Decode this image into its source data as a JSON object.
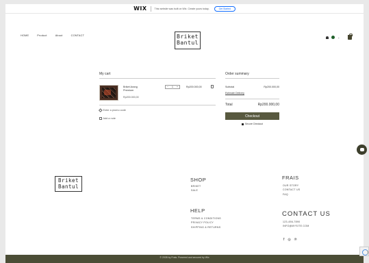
{
  "banner": {
    "logo": "WIX",
    "text": "This website was built on Wix. Create yours today.",
    "button": "Get Started"
  },
  "nav": [
    "HOME",
    "Product",
    "About",
    "CONTACT"
  ],
  "brand": {
    "line1": "Briket",
    "line2": "Bantul"
  },
  "cart": {
    "title": "My cart",
    "item": {
      "name": "Briket Arang Premium",
      "price": "Rp200.000,00",
      "qty": "1",
      "total": "Rp200.000,00"
    },
    "promo": "Enter a promo code",
    "note": "Add a note"
  },
  "summary": {
    "title": "Order summary",
    "subtotal_label": "Subtotal",
    "subtotal_value": "Rp200.000,00",
    "estimate": "Estimate Delivery",
    "total_label": "Total",
    "total_value": "Rp200.000,00",
    "checkout": "Checkout",
    "secure": "Secure Checkout"
  },
  "footer": {
    "shop": {
      "title": "SHOP",
      "links": [
        "BRIKET",
        "SALE"
      ]
    },
    "help": {
      "title": "HELP",
      "links": [
        "TERMS & CONDITIONS",
        "PRIVACY POLICY",
        "SHIPPING & RETURNS"
      ]
    },
    "frais": {
      "title": "FRAIS",
      "links": [
        "OUR STORY",
        "CONTACT US",
        "FAQ"
      ]
    },
    "contact": {
      "title": "CONTACT US",
      "lines": [
        "123-456-7890",
        "INFO@MYSITE.COM"
      ]
    },
    "social": [
      "f",
      "◎",
      "℗"
    ],
    "copyright": "© 2035 by Frais. Powered and secured by Wix"
  },
  "colors": {
    "accent": "#58593f",
    "footer_bar": "#4b4d36"
  }
}
